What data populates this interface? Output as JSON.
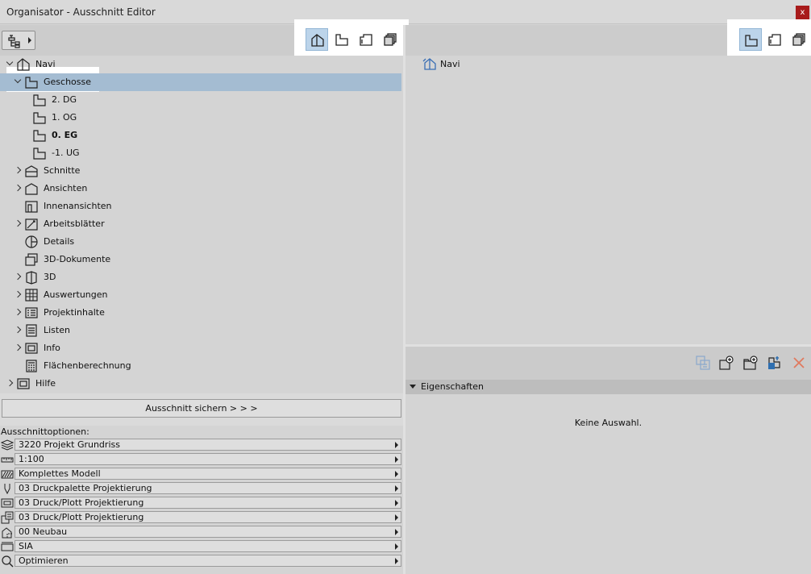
{
  "window": {
    "title": "Organisator - Ausschnitt Editor",
    "close_label": "x"
  },
  "tree": {
    "items": [
      {
        "label": "Navi",
        "icon": "navi-icon",
        "level": 0,
        "twisty": "open",
        "bold": false
      },
      {
        "label": "Geschosse",
        "icon": "story-icon",
        "level": 1,
        "twisty": "open",
        "bold": false,
        "selected": true
      },
      {
        "label": "2. DG",
        "icon": "story-icon",
        "level": 2,
        "twisty": "none",
        "bold": false
      },
      {
        "label": "1. OG",
        "icon": "story-icon",
        "level": 2,
        "twisty": "none",
        "bold": false
      },
      {
        "label": "0. EG",
        "icon": "story-icon",
        "level": 2,
        "twisty": "none",
        "bold": true
      },
      {
        "label": "-1. UG",
        "icon": "story-icon",
        "level": 2,
        "twisty": "none",
        "bold": false
      },
      {
        "label": "Schnitte",
        "icon": "section-icon",
        "level": 1,
        "twisty": "closed",
        "bold": false
      },
      {
        "label": "Ansichten",
        "icon": "elevation-icon",
        "level": 1,
        "twisty": "closed",
        "bold": false
      },
      {
        "label": "Innenansichten",
        "icon": "interior-elevation-icon",
        "level": 1,
        "twisty": "none",
        "bold": false
      },
      {
        "label": "Arbeitsblätter",
        "icon": "worksheet-icon",
        "level": 1,
        "twisty": "closed",
        "bold": false
      },
      {
        "label": "Details",
        "icon": "detail-icon",
        "level": 1,
        "twisty": "none",
        "bold": false
      },
      {
        "label": "3D-Dokumente",
        "icon": "3d-document-icon",
        "level": 1,
        "twisty": "none",
        "bold": false
      },
      {
        "label": "3D",
        "icon": "3d-icon",
        "level": 1,
        "twisty": "closed",
        "bold": false
      },
      {
        "label": "Auswertungen",
        "icon": "schedule-icon",
        "level": 1,
        "twisty": "closed",
        "bold": false
      },
      {
        "label": "Projektinhalte",
        "icon": "project-index-icon",
        "level": 1,
        "twisty": "closed",
        "bold": false
      },
      {
        "label": "Listen",
        "icon": "list-icon",
        "level": 1,
        "twisty": "closed",
        "bold": false
      },
      {
        "label": "Info",
        "icon": "info-icon",
        "level": 1,
        "twisty": "closed",
        "bold": false
      },
      {
        "label": "Flächenberechnung",
        "icon": "calculation-icon",
        "level": 1,
        "twisty": "none",
        "bold": false
      },
      {
        "label": "Hilfe",
        "icon": "help-icon",
        "level": 0,
        "twisty": "closed",
        "bold": false
      }
    ]
  },
  "save_button": {
    "label": "Ausschnitt sichern > > >"
  },
  "options": {
    "title": "Ausschnittoptionen:",
    "rows": [
      {
        "value": "3220 Projekt Grundriss",
        "icon": "layer-combination-icon"
      },
      {
        "value": "1:100",
        "icon": "scale-icon"
      },
      {
        "value": "Komplettes Modell",
        "icon": "structure-display-icon"
      },
      {
        "value": "03 Druckpalette Projektierung",
        "icon": "pen-set-icon"
      },
      {
        "value": "03 Druck/Plott Projektierung",
        "icon": "model-view-options-icon"
      },
      {
        "value": "03 Druck/Plott Projektierung",
        "icon": "graphic-override-icon"
      },
      {
        "value": "00 Neubau",
        "icon": "renovation-filter-icon"
      },
      {
        "value": "SIA",
        "icon": "dimension-icon"
      },
      {
        "value": "Optimieren",
        "icon": "zoom-icon"
      }
    ]
  },
  "right_tree": {
    "root_label": "Navi"
  },
  "properties": {
    "header": "Eigenschaften",
    "empty_text": "Keine Auswahl."
  }
}
